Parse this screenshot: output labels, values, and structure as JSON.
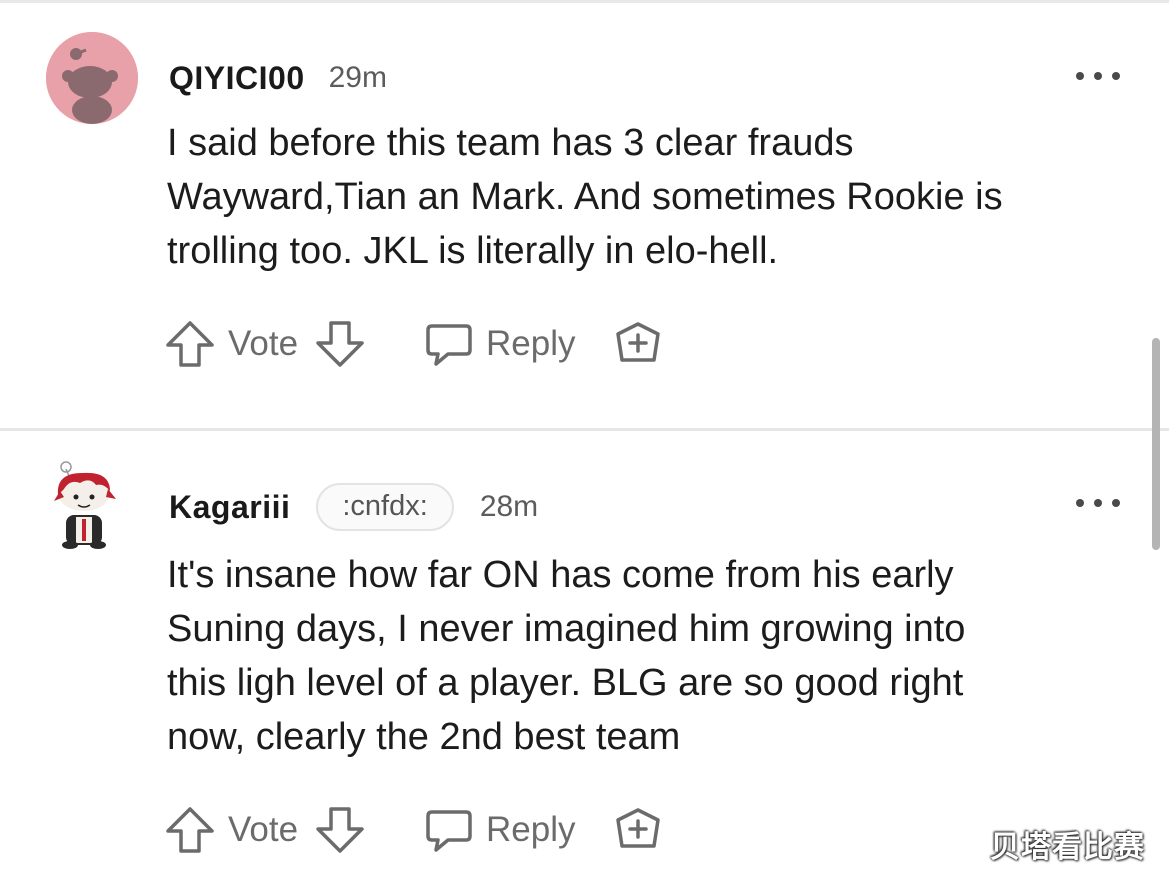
{
  "comments": [
    {
      "username": "QIYICI00",
      "flair": "",
      "time": "29m",
      "avatar_icon": "snoo-avatar-pink",
      "lines": [
        "I said before this team has 3 clear frauds",
        "Wayward,Tian an Mark. And sometimes Rookie is",
        "trolling too. JKL is literally in elo-hell."
      ],
      "vote_label": "Vote",
      "reply_label": "Reply"
    },
    {
      "username": "Kagariii",
      "flair": ":cnfdx:",
      "time": "28m",
      "avatar_icon": "snoo-avatar-red-hair",
      "lines": [
        "It's insane how far ON has come from his early",
        "Suning days, I never imagined him growing into",
        "this ligh level of a player. BLG are so good right",
        "now, clearly the 2nd best team"
      ],
      "vote_label": "Vote",
      "reply_label": "Reply"
    }
  ],
  "watermark": "贝塔看比赛",
  "colors": {
    "avatar_pink": "#e8a1a8",
    "text": "#1c1c1c",
    "muted": "#6b6b6b",
    "divider": "#e6e6e6"
  }
}
